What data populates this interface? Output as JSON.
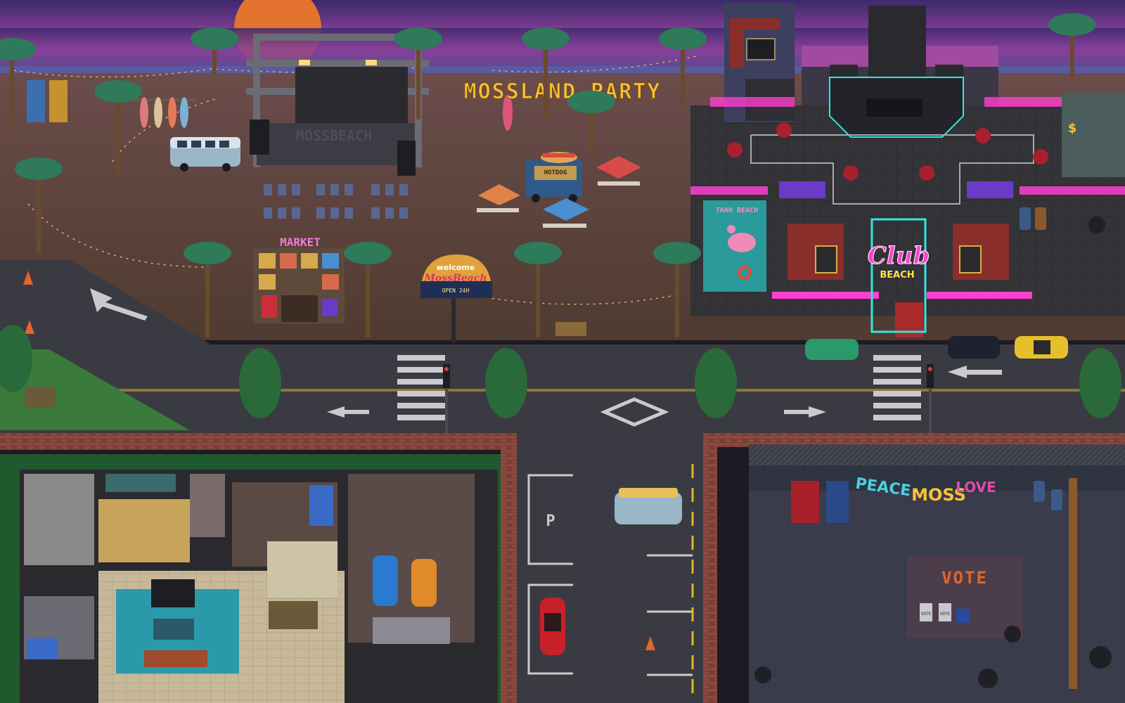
{
  "beach": {
    "party_sign": "MOSSLAND PARTY",
    "stage_banner": "MOSSBEACH",
    "market_sign": "MARKET",
    "welcome_sign": {
      "line1": "welcome",
      "line2": "MossBeach",
      "line3": "OPEN 24H"
    },
    "hotdog_sign": "HOTDOG"
  },
  "club": {
    "name": "Club",
    "subtitle": "BEACH",
    "pool_sign": "THAN BEACH",
    "vault_symbol": "$"
  },
  "lot": {
    "parking_letter": "P",
    "graffiti": [
      "PEACE",
      "MOSS",
      "LOVE"
    ],
    "vote_sign": "VOTE",
    "ballot_labels": [
      "VOTE",
      "VOTE"
    ]
  },
  "colors": {
    "sky_top": "#3b2a6b",
    "sky_mid": "#8a3f98",
    "sand": "#5a4536",
    "road": "#3a3a42",
    "neon_pink": "#ff3fd0",
    "neon_cyan": "#33e6e0",
    "party_sign": "#f7c23a",
    "club_floor": "#2a2a2e"
  },
  "icons": [
    "palm-tree-icon",
    "traffic-light-icon",
    "traffic-cone-icon",
    "road-arrow-icon",
    "van-icon",
    "car-icon",
    "flamingo-float-icon"
  ]
}
